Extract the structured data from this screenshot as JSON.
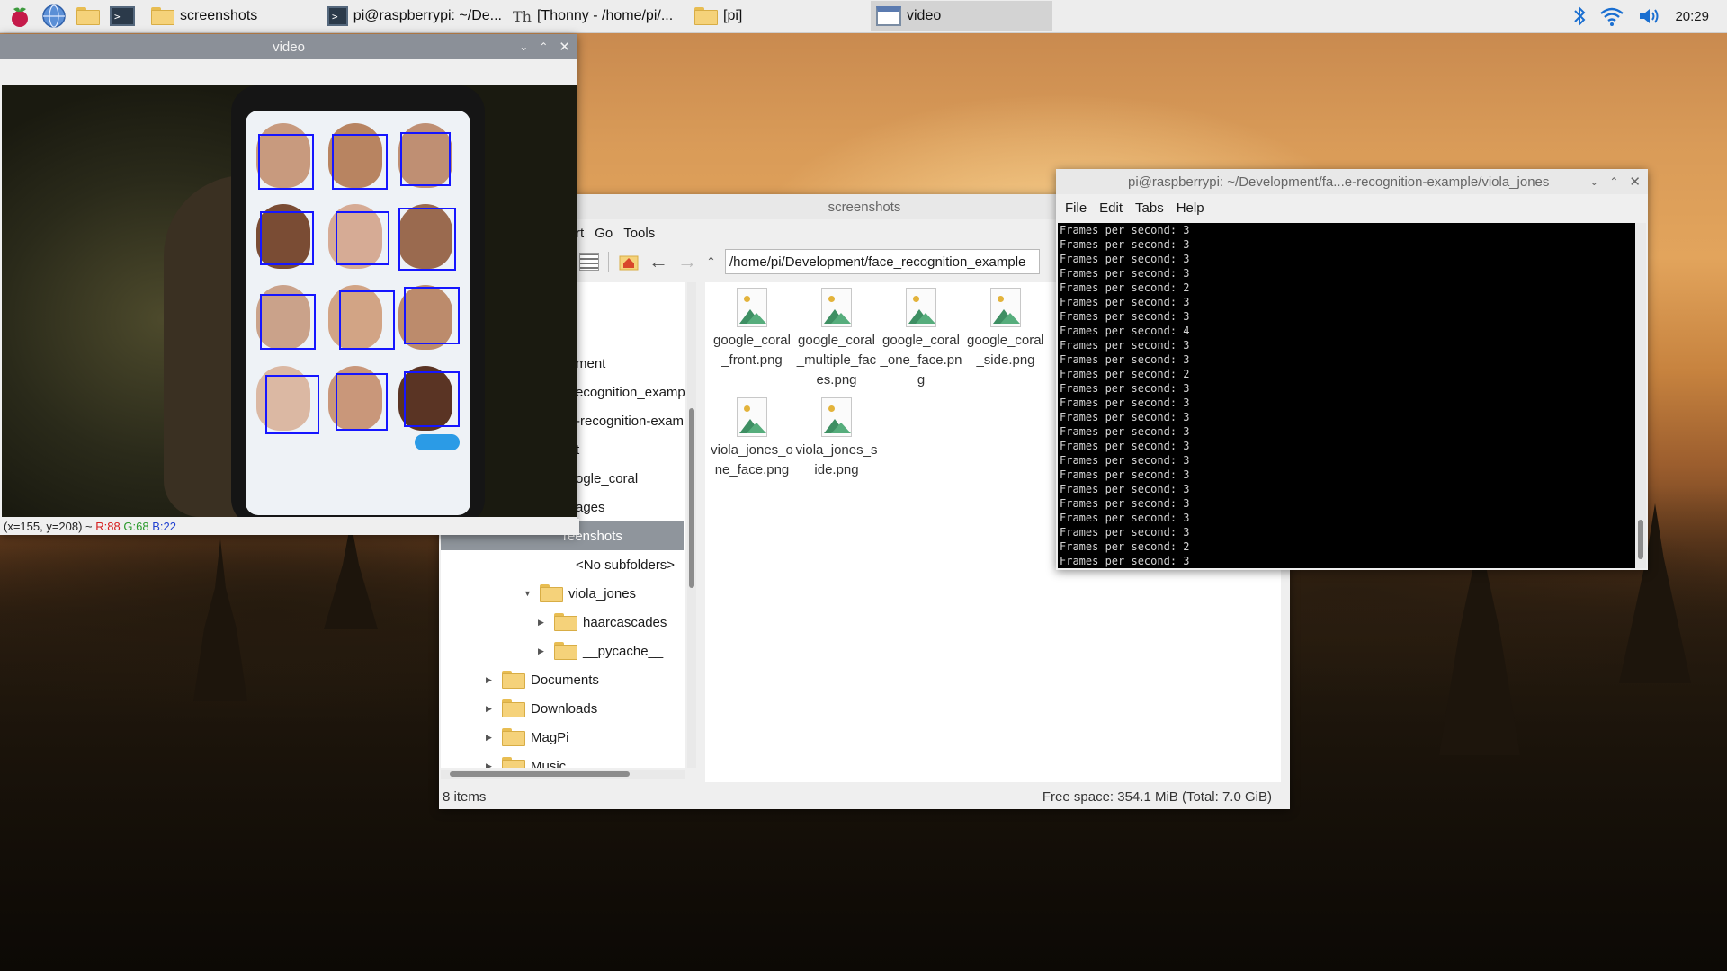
{
  "taskbar": {
    "tasks": [
      {
        "label": "screenshots"
      },
      {
        "label": "pi@raspberrypi: ~/De..."
      },
      {
        "label": "[Thonny  -  /home/pi/..."
      },
      {
        "label": "[pi]"
      },
      {
        "label": "video"
      }
    ],
    "clock": "20:29"
  },
  "video_window": {
    "title": "video",
    "status": "(x=155, y=208) ~",
    "status_r": "R:88",
    "status_g": "G:68",
    "status_b": "B:22"
  },
  "file_manager": {
    "title": "screenshots",
    "menu": [
      "rt",
      "Go",
      "Tools"
    ],
    "path": "/home/pi/Development/face_recognition_example",
    "tree": [
      {
        "label": "ment"
      },
      {
        "label": "ecognition_examp"
      },
      {
        "label": "-recognition-exam"
      },
      {
        "label": "t"
      },
      {
        "label": "ogle_coral"
      },
      {
        "label": "ages"
      },
      {
        "label": "reenshots"
      },
      {
        "label": "<No subfolders>"
      },
      {
        "label": "viola_jones"
      },
      {
        "label": "haarcascades"
      },
      {
        "label": "__pycache__"
      },
      {
        "label": "Documents"
      },
      {
        "label": "Downloads"
      },
      {
        "label": "MagPi"
      },
      {
        "label": "Music"
      }
    ],
    "files": [
      {
        "name": "google_coral_front.png"
      },
      {
        "name": "google_coral_multiple_faces.png"
      },
      {
        "name": "google_coral_one_face.png"
      },
      {
        "name": "google_coral_side.png"
      },
      {
        "name": "viola_jones_one_face.png"
      },
      {
        "name": "viola_jones_side.png"
      }
    ],
    "item_count": "8 items",
    "free_space": "Free space: 354.1 MiB (Total: 7.0 GiB)"
  },
  "terminal": {
    "title": "pi@raspberrypi: ~/Development/fa...e-recognition-example/viola_jones",
    "menu": [
      "File",
      "Edit",
      "Tabs",
      "Help"
    ],
    "lines": [
      "Frames per second: 3",
      "Frames per second: 3",
      "Frames per second: 3",
      "Frames per second: 3",
      "Frames per second: 2",
      "Frames per second: 3",
      "Frames per second: 3",
      "Frames per second: 4",
      "Frames per second: 3",
      "Frames per second: 3",
      "Frames per second: 2",
      "Frames per second: 3",
      "Frames per second: 3",
      "Frames per second: 3",
      "Frames per second: 3",
      "Frames per second: 3",
      "Frames per second: 3",
      "Frames per second: 3",
      "Frames per second: 3",
      "Frames per second: 3",
      "Frames per second: 3",
      "Frames per second: 3",
      "Frames per second: 2",
      "Frames per second: 3"
    ]
  }
}
